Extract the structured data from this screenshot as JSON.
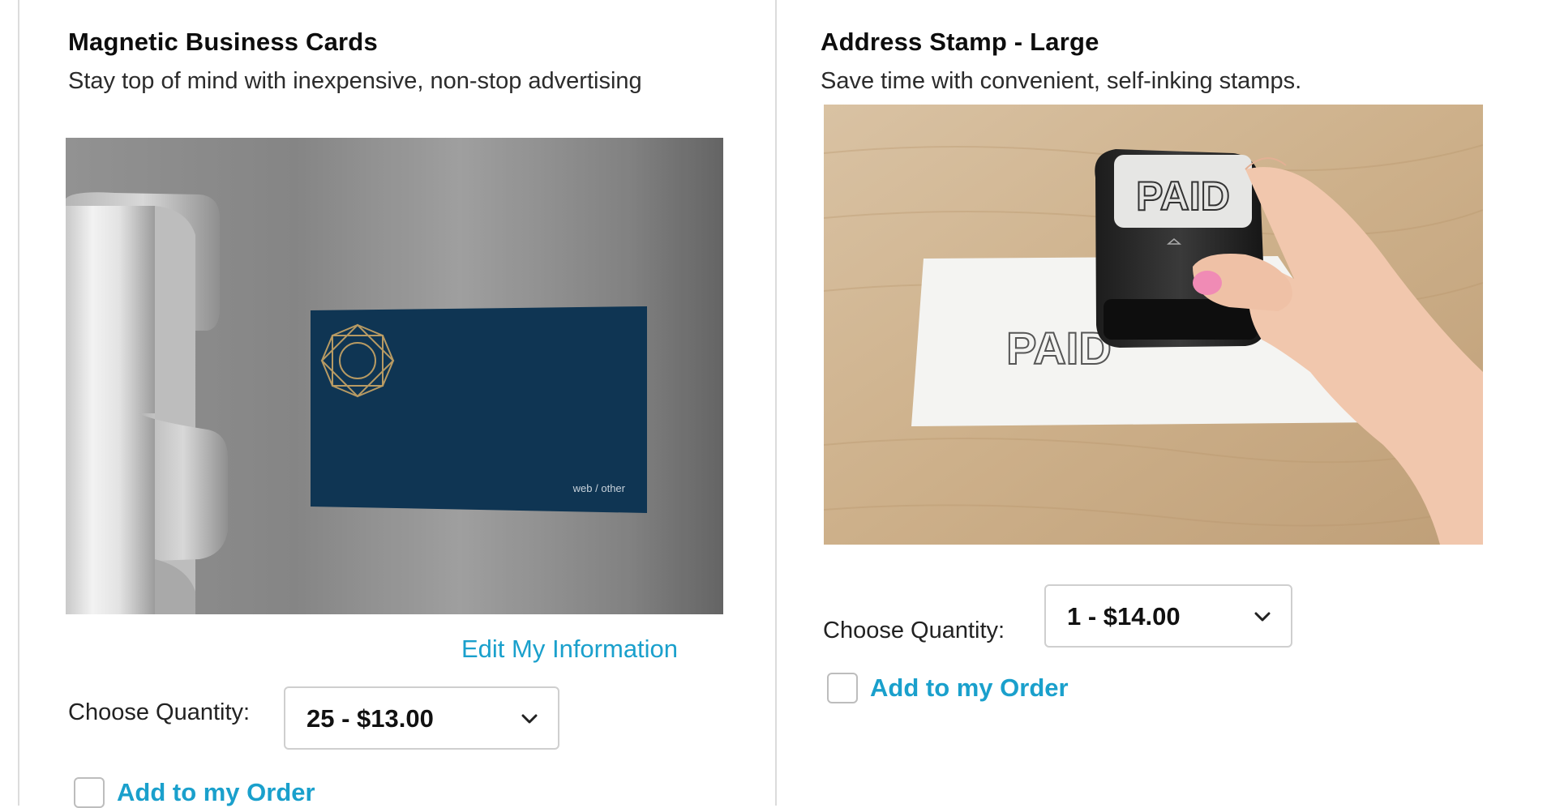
{
  "products": [
    {
      "title": "Magnetic Business Cards",
      "description": "Stay top of mind with inexpensive, non-stop advertising",
      "image_card_text": "web / other",
      "edit_label": "Edit My Information",
      "quantity_label": "Choose Quantity:",
      "quantity_value": "25 - $13.00",
      "add_label": "Add to my Order"
    },
    {
      "title": "Address Stamp - Large",
      "description": "Save time with convenient, self-inking stamps.",
      "stamp_text": "PAID",
      "paper_text": "PAID",
      "quantity_label": "Choose Quantity:",
      "quantity_value": "1 - $14.00",
      "add_label": "Add to my Order"
    }
  ],
  "colors": {
    "link": "#1aa0cc",
    "card_navy": "#0f3553",
    "divider": "#dcdcdc"
  }
}
